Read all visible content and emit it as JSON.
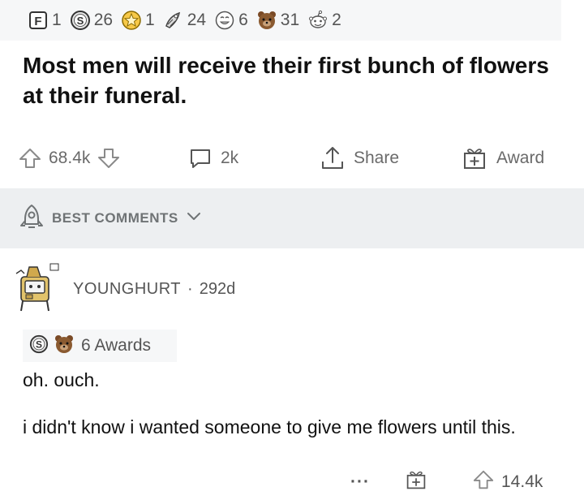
{
  "post_awards": [
    {
      "icon": "f-award-icon",
      "count": "1"
    },
    {
      "icon": "silver-s-award-icon",
      "count": "26"
    },
    {
      "icon": "star-award-icon",
      "count": "1"
    },
    {
      "icon": "rocket-like-award-icon",
      "count": "24"
    },
    {
      "icon": "laughing-award-icon",
      "count": "6"
    },
    {
      "icon": "bear-award-icon",
      "count": "31"
    },
    {
      "icon": "snoo-award-icon",
      "count": "2"
    }
  ],
  "post": {
    "title": "Most men will receive their first bunch of flowers at their funeral.",
    "votes": "68.4k",
    "comments": "2k",
    "share_label": "Share",
    "award_label": "Award"
  },
  "sort": {
    "label": "BEST COMMENTS"
  },
  "comment": {
    "username": "YOUNGHURT",
    "separator": "·",
    "age": "292d",
    "awards_label": "6 Awards",
    "paragraphs": [
      "oh. ouch.",
      "i didn't know i wanted someone to give me flowers until this."
    ],
    "more": "···",
    "votes": "14.4k"
  },
  "colors": {
    "text": "#1a1a1b",
    "muted": "#6a6a6a",
    "band": "#edeff1",
    "award_band": "#f6f7f8"
  }
}
